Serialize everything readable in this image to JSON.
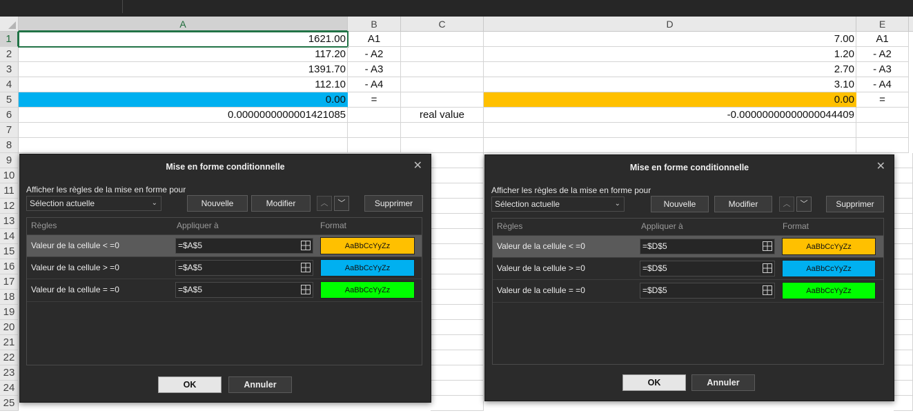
{
  "columns": [
    "A",
    "B",
    "C",
    "D",
    "E"
  ],
  "rows": [
    "1",
    "2",
    "3",
    "4",
    "5",
    "6",
    "7",
    "8",
    "9",
    "10",
    "11",
    "12",
    "13",
    "14",
    "15",
    "16",
    "17",
    "18",
    "19",
    "20",
    "21",
    "22",
    "23",
    "24",
    "25"
  ],
  "cells": {
    "A1": "1621.00",
    "B1": "A1",
    "D1": "7.00",
    "E1": "A1",
    "A2": "117.20",
    "B2": "- A2",
    "D2": "1.20",
    "E2": "- A2",
    "A3": "1391.70",
    "B3": "- A3",
    "D3": "2.70",
    "E3": "- A3",
    "A4": "112.10",
    "B4": "- A4",
    "D4": "3.10",
    "E4": "- A4",
    "A5": "0.00",
    "B5": "=",
    "D5": "0.00",
    "E5": "=",
    "A6": "0.0000000000001421085",
    "C6": "real value",
    "D6": "-0.00000000000000044409"
  },
  "colors": {
    "blue": "#00b0f0",
    "orange": "#ffc000",
    "green": "#00ff00",
    "accent": "#217346"
  },
  "dialogs": [
    {
      "title": "Mise en forme conditionnelle",
      "show_rules_label": "Afficher les règles de la mise en forme pour",
      "selection_value": "Sélection actuelle",
      "buttons": {
        "new": "Nouvelle",
        "edit": "Modifier",
        "delete": "Supprimer",
        "ok": "OK",
        "cancel": "Annuler"
      },
      "headers": {
        "rules": "Règles",
        "applies": "Appliquer à",
        "format": "Format"
      },
      "rules": [
        {
          "name": "Valeur de la cellule < =0",
          "applies": "=$A$5",
          "preview": "AaBbCcYyZz"
        },
        {
          "name": "Valeur de la cellule > =0",
          "applies": "=$A$5",
          "preview": "AaBbCcYyZz"
        },
        {
          "name": "Valeur de la cellule = =0",
          "applies": "=$A$5",
          "preview": "AaBbCcYyZz"
        }
      ]
    },
    {
      "title": "Mise en forme conditionnelle",
      "show_rules_label": "Afficher les règles de la mise en forme pour",
      "selection_value": "Sélection actuelle",
      "buttons": {
        "new": "Nouvelle",
        "edit": "Modifier",
        "delete": "Supprimer",
        "ok": "OK",
        "cancel": "Annuler"
      },
      "headers": {
        "rules": "Règles",
        "applies": "Appliquer à",
        "format": "Format"
      },
      "rules": [
        {
          "name": "Valeur de la cellule < =0",
          "applies": "=$D$5",
          "preview": "AaBbCcYyZz"
        },
        {
          "name": "Valeur de la cellule > =0",
          "applies": "=$D$5",
          "preview": "AaBbCcYyZz"
        },
        {
          "name": "Valeur de la cellule = =0",
          "applies": "=$D$5",
          "preview": "AaBbCcYyZz"
        }
      ]
    }
  ]
}
